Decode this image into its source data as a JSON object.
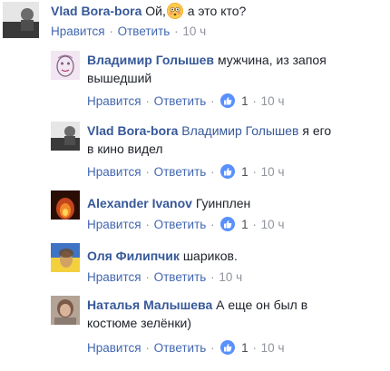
{
  "actions": {
    "like": "Нравится",
    "reply": "Ответить",
    "sep": "·"
  },
  "comments": [
    {
      "author": "Vlad Bora-bora",
      "text_before": "Ой,",
      "emoji": "flushed-face-emoji",
      "text_after": "а это кто?",
      "likes": "",
      "time": "10 ч"
    },
    {
      "author": "Владимир Голышев",
      "text_line1": "мужчина, из запоя",
      "text_line2": "вышедший",
      "likes": "1",
      "time": "10 ч"
    },
    {
      "author": "Vlad Bora-bora",
      "mention": "Владимир Голышев",
      "text_line1": "я его",
      "text_line2": "в кино видел",
      "likes": "1",
      "time": "10 ч"
    },
    {
      "author": "Alexander Ivanov",
      "text_line1": "Гуинплен",
      "likes": "1",
      "time": "10 ч"
    },
    {
      "author": "Оля Филипчик",
      "text_line1": "шариков.",
      "likes": "",
      "time": "10 ч"
    },
    {
      "author": "Наталья Малышева",
      "text_line1": "А еще он был в",
      "text_line2": "костюме зелёнки)",
      "likes": "1",
      "time": "10 ч"
    }
  ],
  "colors": {
    "author": "#365899",
    "action_link": "#4267b2",
    "meta": "#90949c",
    "like_badge": "#5890ff"
  }
}
